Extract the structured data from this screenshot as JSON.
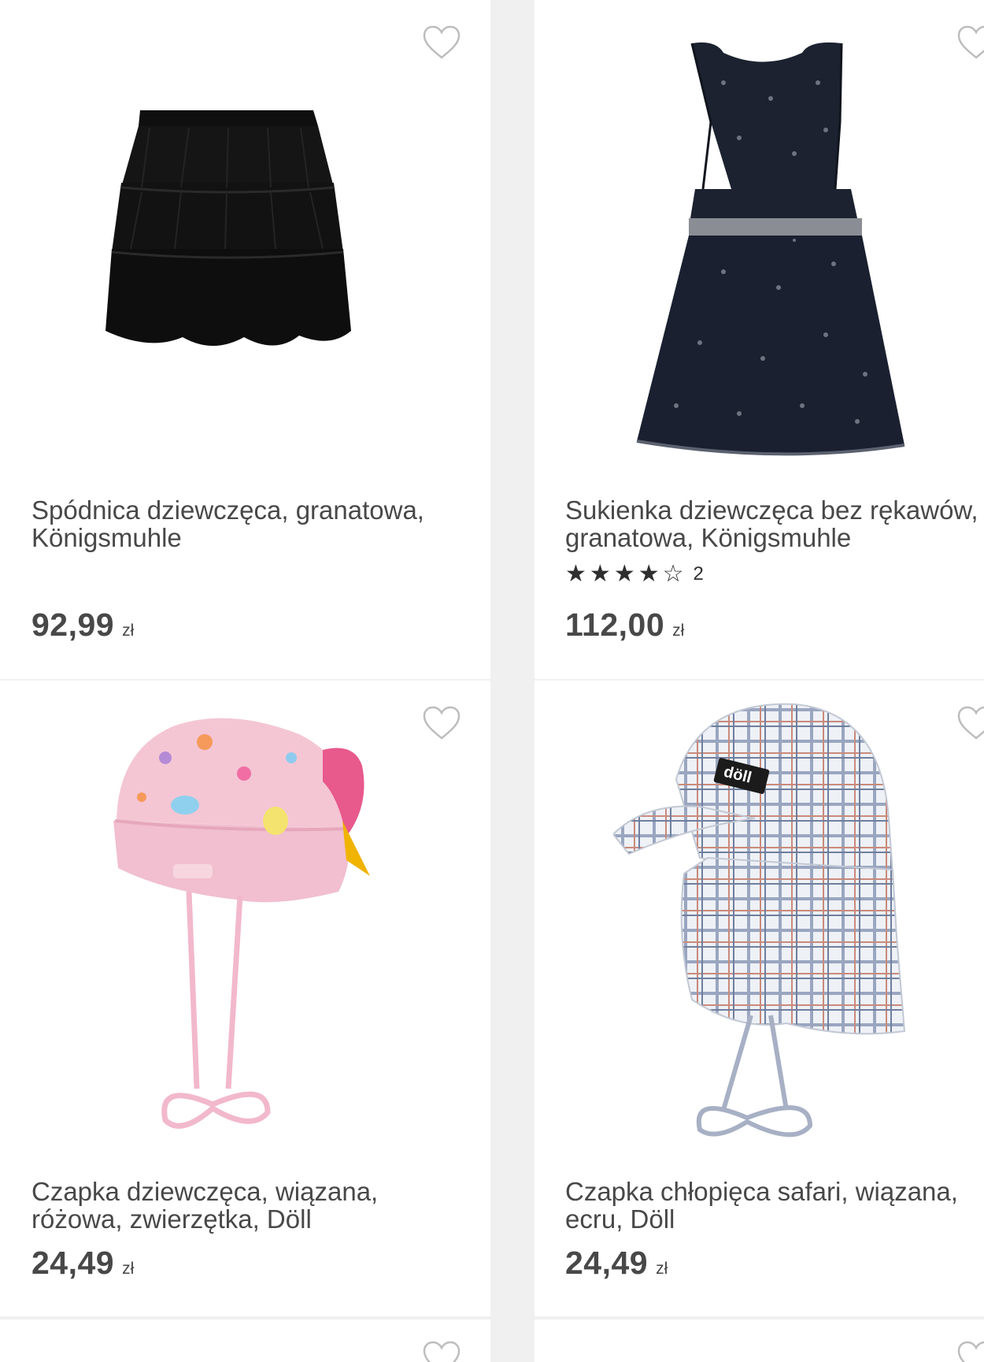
{
  "products": [
    {
      "title_line1": "Spódnica dziewczęca, granatowa,",
      "title_line2": "Königsmuhle",
      "price": "92,99",
      "currency": "zł",
      "image": "black tiered tulle skirt"
    },
    {
      "title_line1": "Sukienka dziewczęca bez rękawów,",
      "title_line2": "granatowa, Königsmuhle",
      "rating_count": "2",
      "rating_value": 4,
      "price": "112,00",
      "currency": "zł",
      "image": "navy sleeveless star dress"
    },
    {
      "title_line1": "Czapka dziewczęca, wiązana,",
      "title_line2": "różowa, zwierzętka, Döll",
      "price": "24,49",
      "currency": "zł",
      "image": "pink tied bandana hat with animals"
    },
    {
      "title_line1": "Czapka chłopięca safari, wiązana,",
      "title_line2": "ecru, Döll",
      "price": "24,49",
      "currency": "zł",
      "image": "plaid safari cap with neck flap",
      "brand_tag": "döll"
    }
  ],
  "icons": {
    "favorite": "heart-outline-icon",
    "star_filled": "★",
    "star_empty": "☆"
  },
  "colors": {
    "background": "#f0f0f0",
    "card": "#ffffff",
    "text": "#484848",
    "heart_stroke": "#bdbdbd"
  }
}
